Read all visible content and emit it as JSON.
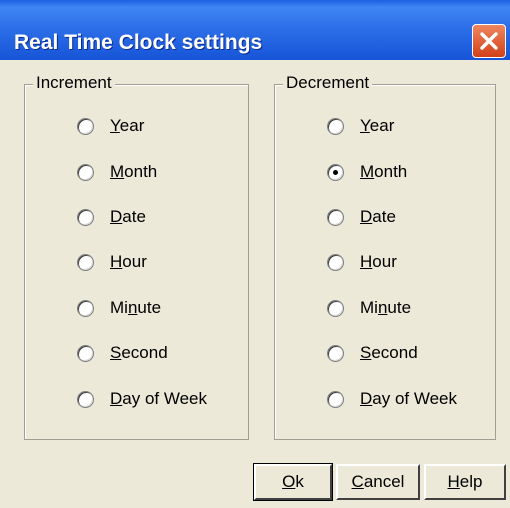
{
  "window": {
    "title": "Real Time Clock settings",
    "close_icon": "close-icon"
  },
  "increment": {
    "label": "Increment",
    "options": [
      "Year",
      "Month",
      "Date",
      "Hour",
      "Minute",
      "Second",
      "Day of Week"
    ],
    "selected": null
  },
  "decrement": {
    "label": "Decrement",
    "options": [
      "Year",
      "Month",
      "Date",
      "Hour",
      "Minute",
      "Second",
      "Day of Week"
    ],
    "selected": "Month"
  },
  "buttons": {
    "ok": "Ok",
    "cancel": "Cancel",
    "help": "Help"
  },
  "colors": {
    "title_bar": "#2d6fe8",
    "close_button": "#d2401a",
    "dialog_background": "#ece9d8"
  }
}
